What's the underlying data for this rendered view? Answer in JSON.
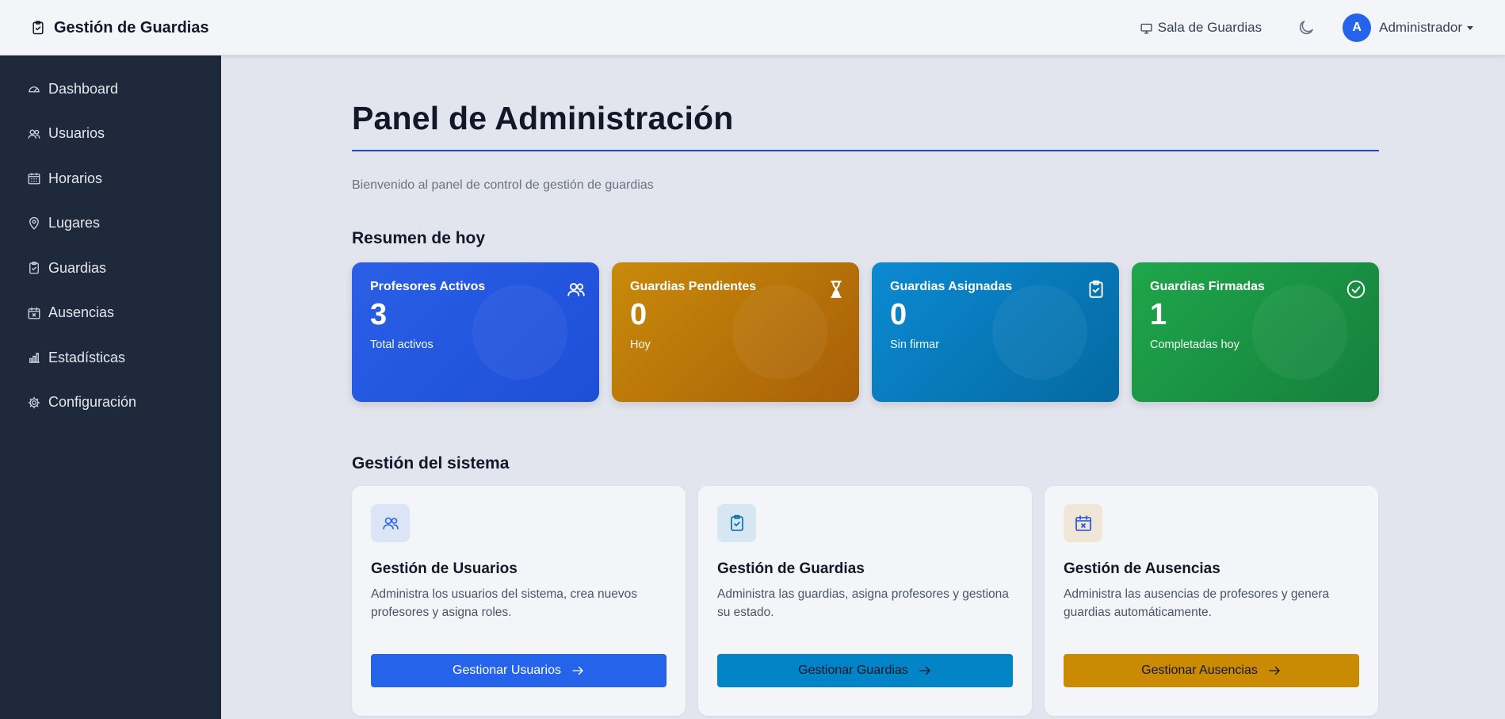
{
  "header": {
    "brand": "Gestión de Guardias",
    "brand_icon": "clipboard-check-icon",
    "sala_link": "Sala de Guardias",
    "sala_icon": "monitor-icon",
    "theme_icon": "moon-icon",
    "user_initial": "A",
    "user_name": "Administrador"
  },
  "sidebar": {
    "items": [
      {
        "label": "Dashboard",
        "icon": "speedometer-icon"
      },
      {
        "label": "Usuarios",
        "icon": "users-icon"
      },
      {
        "label": "Horarios",
        "icon": "calendar-grid-icon"
      },
      {
        "label": "Lugares",
        "icon": "map-pin-icon"
      },
      {
        "label": "Guardias",
        "icon": "clipboard-check-icon"
      },
      {
        "label": "Ausencias",
        "icon": "calendar-x-icon"
      },
      {
        "label": "Estadísticas",
        "icon": "bar-chart-icon"
      },
      {
        "label": "Configuración",
        "icon": "gear-icon"
      }
    ]
  },
  "main": {
    "title": "Panel de Administración",
    "welcome": "Bienvenido al panel de control de gestión de guardias",
    "resumen_title": "Resumen de hoy",
    "stats": [
      {
        "label": "Profesores Activos",
        "value": "3",
        "sub": "Total activos",
        "icon": "users-icon",
        "color": "#2563eb"
      },
      {
        "label": "Guardias Pendientes",
        "value": "0",
        "sub": "Hoy",
        "icon": "hourglass-icon",
        "color": "#b45309"
      },
      {
        "label": "Guardias Asignadas",
        "value": "0",
        "sub": "Sin firmar",
        "icon": "clipboard-check-icon",
        "color": "#0369a1"
      },
      {
        "label": "Guardias Firmadas",
        "value": "1",
        "sub": "Completadas hoy",
        "icon": "check-circle-icon",
        "color": "#16a34a"
      }
    ],
    "gestion_title": "Gestión del sistema",
    "cards": [
      {
        "title": "Gestión de Usuarios",
        "desc": "Administra los usuarios del sistema, crea nuevos profesores y asigna roles.",
        "button": "Gestionar Usuarios",
        "icon": "users-icon"
      },
      {
        "title": "Gestión de Guardias",
        "desc": "Administra las guardias, asigna profesores y gestiona su estado.",
        "button": "Gestionar Guardias",
        "icon": "clipboard-check-icon"
      },
      {
        "title": "Gestión de Ausencias",
        "desc": "Administra las ausencias de profesores y genera guardias automáticamente.",
        "button": "Gestionar Ausencias",
        "icon": "calendar-x-icon"
      }
    ]
  }
}
